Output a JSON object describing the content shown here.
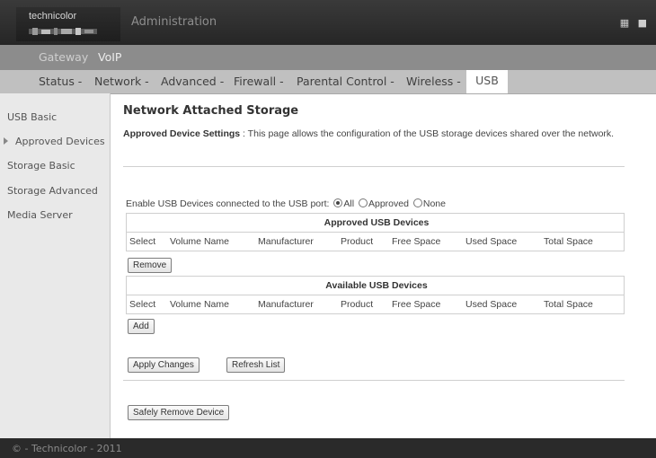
{
  "header": {
    "logo_text": "technicolor",
    "title": "Administration",
    "icons": [
      "language-icon",
      "menu-icon"
    ]
  },
  "sections": {
    "gateway": "Gateway",
    "voip": "VoIP"
  },
  "nav": {
    "items": [
      "Status -",
      "Network -",
      "Advanced -",
      "Firewall -",
      "Parental Control -",
      "Wireless -"
    ],
    "active": "USB"
  },
  "sidebar": {
    "items": [
      "USB Basic",
      "Approved Devices",
      "Storage Basic",
      "Storage Advanced",
      "Media Server"
    ],
    "active_index": 1
  },
  "main": {
    "title": "Network Attached Storage",
    "desc_bold": "Approved Device Settings",
    "desc_text": " :  This page allows the configuration of the USB storage devices shared over the network.",
    "enable_label": "Enable USB Devices connected to the USB port:",
    "radio_all": "All",
    "radio_approved": "Approved",
    "radio_none": "None",
    "radio_selected": "All",
    "approved_table": {
      "caption": "Approved USB Devices",
      "columns": [
        "Select",
        "Volume Name",
        "Manufacturer",
        "Product",
        "Free Space",
        "Used Space",
        "Total Space"
      ]
    },
    "available_table": {
      "caption": "Available USB Devices",
      "columns": [
        "Select",
        "Volume Name",
        "Manufacturer",
        "Product",
        "Free Space",
        "Used Space",
        "Total Space"
      ]
    },
    "remove_button": "Remove",
    "add_button": "Add",
    "apply_button": "Apply Changes",
    "refresh_button": "Refresh List",
    "safely_remove_button": "Safely Remove Device"
  },
  "footer": {
    "text": "© - Technicolor - 2011"
  }
}
